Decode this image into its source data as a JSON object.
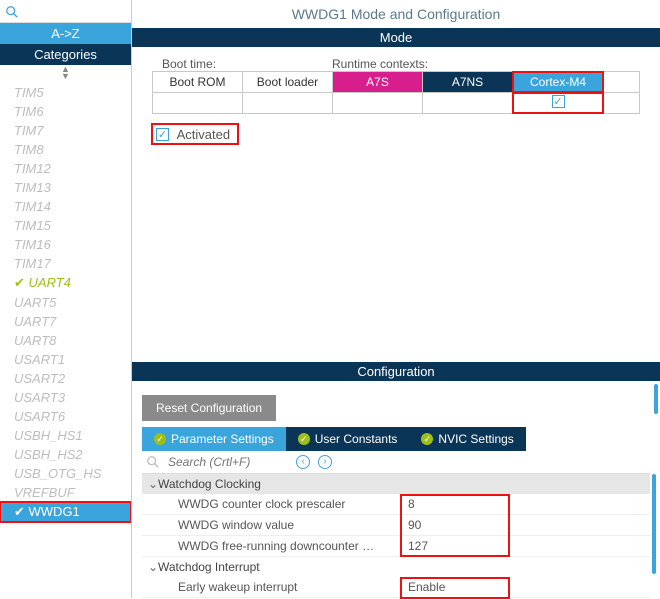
{
  "sidebar": {
    "sort_label": "A->Z",
    "categories_label": "Categories",
    "items": [
      {
        "label": "TIM5"
      },
      {
        "label": "TIM6"
      },
      {
        "label": "TIM7"
      },
      {
        "label": "TIM8"
      },
      {
        "label": "TIM12"
      },
      {
        "label": "TIM13"
      },
      {
        "label": "TIM14"
      },
      {
        "label": "TIM15"
      },
      {
        "label": "TIM16"
      },
      {
        "label": "TIM17"
      },
      {
        "label": "UART4"
      },
      {
        "label": "UART5"
      },
      {
        "label": "UART7"
      },
      {
        "label": "UART8"
      },
      {
        "label": "USART1"
      },
      {
        "label": "USART2"
      },
      {
        "label": "USART3"
      },
      {
        "label": "USART6"
      },
      {
        "label": "USBH_HS1"
      },
      {
        "label": "USBH_HS2"
      },
      {
        "label": "USB_OTG_HS"
      },
      {
        "label": "VREFBUF"
      },
      {
        "label": "WWDG1"
      }
    ]
  },
  "title": "WWDG1 Mode and Configuration",
  "mode": {
    "header": "Mode",
    "boot_label": "Boot time:",
    "runtime_label": "Runtime contexts:",
    "cols": {
      "bootrom": "Boot ROM",
      "bootloader": "Boot loader",
      "a7s": "A7S",
      "a7ns": "A7NS",
      "cm4": "Cortex-M4"
    },
    "cm4_checked": "✓",
    "activated_label": "Activated",
    "activated_checked": "✓"
  },
  "config": {
    "header": "Configuration",
    "reset_label": "Reset Configuration",
    "tabs": {
      "param": "Parameter Settings",
      "user": "User Constants",
      "nvic": "NVIC Settings"
    },
    "search_placeholder": "Search (Crtl+F)",
    "groups": {
      "clocking": "Watchdog Clocking",
      "interrupt": "Watchdog Interrupt"
    },
    "params": {
      "prescaler_k": "WWDG counter clock prescaler",
      "prescaler_v": "8",
      "window_k": "WWDG window value",
      "window_v": "90",
      "downcounter_k": "WWDG free-running downcounter …",
      "downcounter_v": "127",
      "earlywake_k": "Early wakeup interrupt",
      "earlywake_v": "Enable"
    }
  }
}
